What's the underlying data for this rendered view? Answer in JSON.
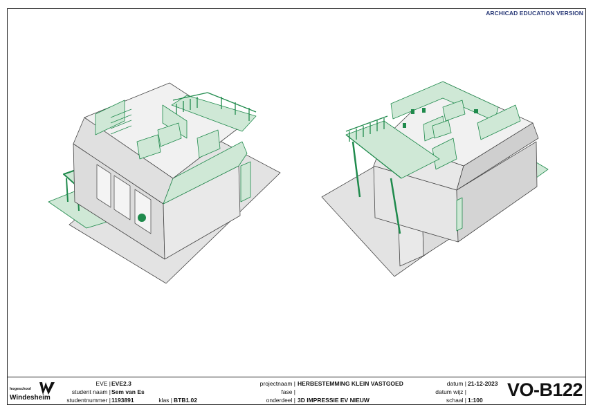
{
  "watermark": "ARCHICAD EDUCATION VERSION",
  "logo": {
    "line1": "hogeschool",
    "line2": "Windesheim"
  },
  "titleblock": {
    "eve_label": "EVE |",
    "eve_value": "EVE2.3",
    "student_label": "student naam |",
    "student_value": "Sem van Es",
    "studentnr_label": "studentnummer |",
    "studentnr_value": "1193891",
    "klas_label": "klas |",
    "klas_value": "BTB1.02",
    "project_label": "projectnaam |",
    "project_value": "HERBESTEMMING KLEIN VASTGOED",
    "fase_label": "fase |",
    "fase_value": "",
    "onderdeel_label": "onderdeel |",
    "onderdeel_value": "3D IMPRESSIE EV NIEUW",
    "datum_label": "datum |",
    "datum_value": "21-12-2023",
    "datumwijz_label": "datum wijz |",
    "datumwijz_value": "",
    "schaal_label": "schaal |",
    "schaal_value": "1:100",
    "sheet_code": "VO-B122"
  },
  "colors": {
    "green_fill": "#cfe8d6",
    "green_line": "#1f8a4c",
    "grey_fill": "#e3e3e3",
    "grey_dark": "#cfcfcf",
    "line": "#444444"
  }
}
